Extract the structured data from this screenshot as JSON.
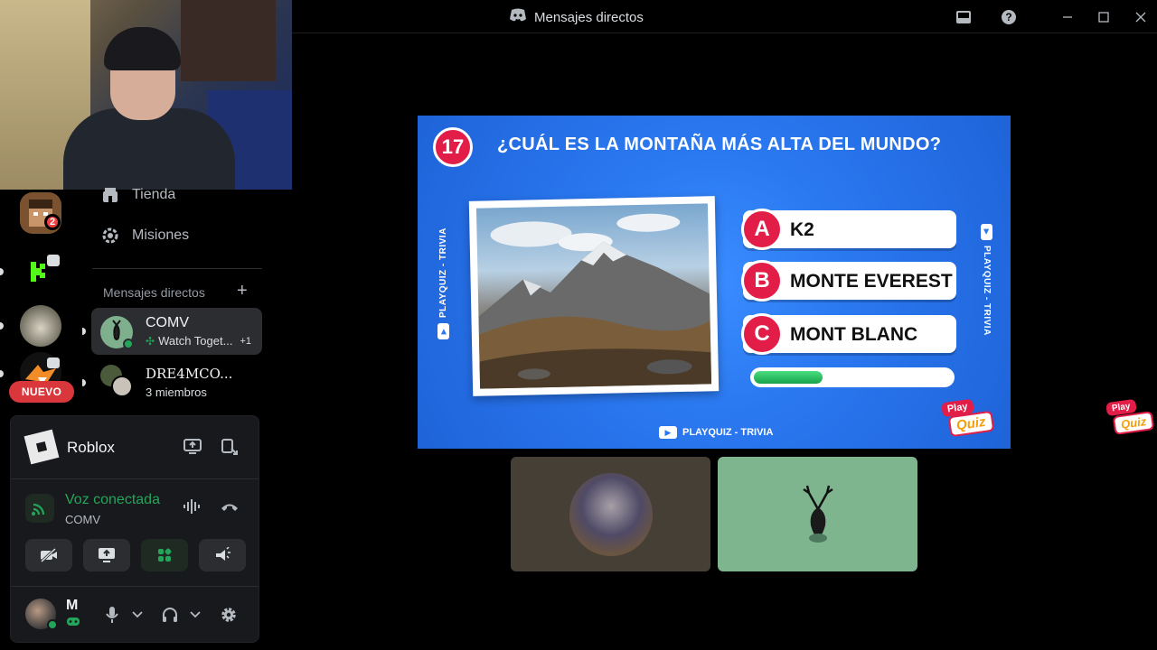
{
  "titlebar": {
    "title": "Mensajes directos",
    "icons": [
      "discord-logo-icon",
      "inbox-icon",
      "help-icon",
      "minimize-icon",
      "maximize-icon",
      "close-icon"
    ]
  },
  "rail": {
    "badge_count": "2",
    "new_label": "NUEVO"
  },
  "sidebar": {
    "nav": [
      {
        "label": "Tienda",
        "icon": "shop-icon"
      },
      {
        "label": "Misiones",
        "icon": "quests-icon"
      }
    ],
    "dm_header": "Mensajes directos",
    "dms": [
      {
        "name": "COMV",
        "sub": "Watch Toget...",
        "extra": "+1"
      },
      {
        "name": "DRE4MCO...",
        "sub": "3 miembros"
      }
    ]
  },
  "panel": {
    "activity_name": "Roblox",
    "voice_title": "Voz conectada",
    "voice_channel": "COMV",
    "user_name": "M",
    "colors": {
      "connected": "#23a55a",
      "accent_red": "#da373c"
    }
  },
  "quiz": {
    "number": "17",
    "question": "¿CUÁL ES LA MONTAÑA MÁS ALTA DEL MUNDO?",
    "answers": [
      {
        "letter": "A",
        "text": "K2"
      },
      {
        "letter": "B",
        "text": "MONTE EVEREST"
      },
      {
        "letter": "C",
        "text": "MONT BLANC"
      }
    ],
    "timer_progress": 0.35,
    "side_left": "PLAYQUIZ - TRIVIA",
    "side_right": "PLAYQUIZ - TRIVIA",
    "footer": "PLAYQUIZ - TRIVIA",
    "logo_top": "Play",
    "logo_bottom": "Quiz"
  }
}
